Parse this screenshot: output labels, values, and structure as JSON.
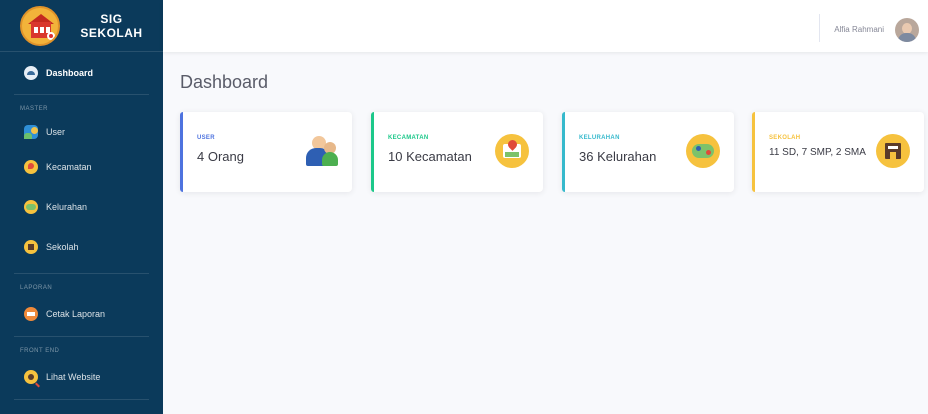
{
  "brand": {
    "line1": "SIG",
    "line2": "SEKOLAH"
  },
  "sidebar": {
    "dashboard": "Dashboard",
    "heading_master": "MASTER",
    "items": [
      "User",
      "Kecamatan",
      "Kelurahan",
      "Sekolah"
    ],
    "heading_laporan": "LAPORAN",
    "laporan": "Cetak Laporan",
    "heading_frontend": "FRONT END",
    "frontend": "Lihat Website"
  },
  "topbar": {
    "user_name": "Alfia Rahmani"
  },
  "main": {
    "title": "Dashboard",
    "cards": [
      {
        "label": "USER",
        "value": "4 Orang",
        "color": "#4e73df",
        "icon": "users-icon"
      },
      {
        "label": "KECAMATAN",
        "value": "10 Kecamatan",
        "color": "#1cc88a",
        "icon": "map-icon"
      },
      {
        "label": "KELURAHAN",
        "value": "36 Kelurahan",
        "color": "#36b9cc",
        "icon": "map-pin-icon"
      },
      {
        "label": "SEKOLAH",
        "value": "11 SD, 7 SMP, 2 SMA",
        "color": "#f6c23e",
        "icon": "school-icon"
      }
    ]
  }
}
